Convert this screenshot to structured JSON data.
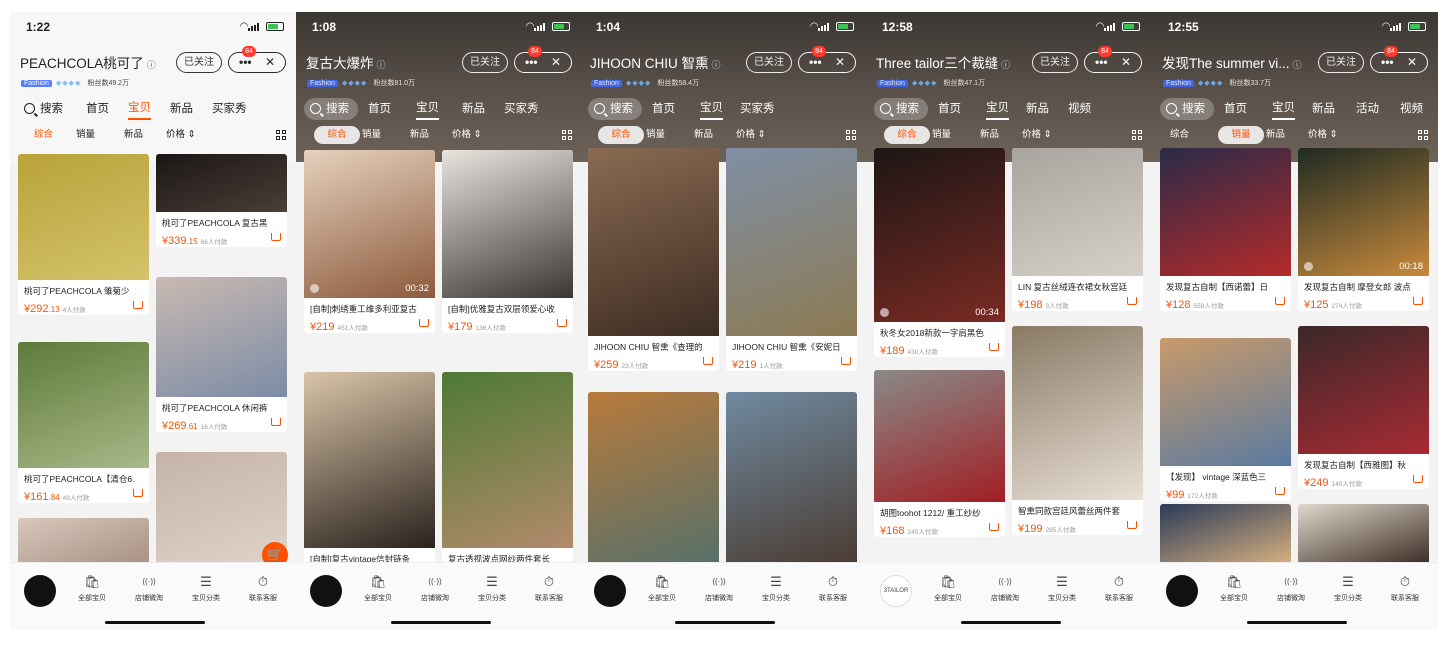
{
  "screens": [
    {
      "theme": "light",
      "time": "1:22",
      "shop_name": "PEACHCOLA桃可了",
      "follow": "已关注",
      "badge": "84",
      "tag": "Fashion",
      "fans": "粉丝数49.2万",
      "search": "搜索",
      "tabs": [
        "首页",
        "宝贝",
        "新品",
        "买家秀"
      ],
      "active_tab": 1,
      "sorts": [
        "综合",
        "销量",
        "新品",
        "价格"
      ],
      "active_sort": 0,
      "left_products": [
        {
          "title": "桃可了PEACHCOLA 雏菊少",
          "price_int": "292",
          "price_dec": ".13",
          "buyers": "4人付款",
          "colors": [
            "#b9a23a",
            "#d4c36a"
          ]
        },
        {
          "title": "桃可了PEACHCOLA【清仓6.",
          "price_int": "161",
          "price_dec": ".84",
          "buyers": "49人付款",
          "colors": [
            "#5d7a3a",
            "#a8b888"
          ]
        },
        {
          "title": "",
          "price_int": "",
          "price_dec": "",
          "buyers": "",
          "colors": [
            "#d8c7bb",
            "#a08a7c"
          ]
        }
      ],
      "right_products": [
        {
          "title": "桃可了PEACHCOLA 复古黑",
          "price_int": "339",
          "price_dec": ".15",
          "buyers": "66人付款",
          "colors": [
            "#1a1615",
            "#4a3e38"
          ]
        },
        {
          "title": "桃可了PEACHCOLA 休闲裤",
          "price_int": "269",
          "price_dec": ".61",
          "buyers": "16人付款",
          "colors": [
            "#c9b9b2",
            "#7c8ca6"
          ]
        },
        {
          "title": "",
          "price_int": "",
          "price_dec": "",
          "buyers": "",
          "colors": [
            "#c5b3a8",
            "#e1d5cc"
          ]
        }
      ],
      "bottom": [
        "全部宝贝",
        "店铺微淘",
        "宝贝分类",
        "联系客服"
      ]
    },
    {
      "theme": "dark",
      "time": "1:08",
      "shop_name": "复古大爆炸",
      "follow": "已关注",
      "badge": "84",
      "tag": "Fashion",
      "fans": "粉丝数81.0万",
      "search": "搜索",
      "tabs": [
        "首页",
        "宝贝",
        "新品",
        "买家秀"
      ],
      "active_tab": 1,
      "sorts": [
        "综合",
        "销量",
        "新品",
        "价格"
      ],
      "active_sort": 0,
      "left_products": [
        {
          "title": "[自制]刺绣重工维多利亚复古",
          "price_int": "219",
          "price_dec": "",
          "buyers": "451人付款",
          "colors": [
            "#e6d1bd",
            "#8c5a3c"
          ],
          "duration": "00:32"
        },
        {
          "title": "[自制]复古vintage信封链条",
          "price_int": "",
          "price_dec": "",
          "buyers": "",
          "colors": [
            "#d9c5a8",
            "#2a221d"
          ]
        }
      ],
      "right_products": [
        {
          "title": "[自制]优雅复古双层领爱心收",
          "price_int": "179",
          "price_dec": "",
          "buyers": "136人付款",
          "colors": [
            "#e8e4de",
            "#3a3633"
          ]
        },
        {
          "title": "复古透视波点网纱两件套长",
          "price_int": "",
          "price_dec": "",
          "buyers": "",
          "colors": [
            "#4e7a34",
            "#b28a6c"
          ]
        }
      ],
      "bottom": [
        "全部宝贝",
        "店铺微淘",
        "宝贝分类",
        "联系客服"
      ]
    },
    {
      "theme": "dark",
      "time": "1:04",
      "shop_name": "JIHOON CHIU 智熏",
      "follow": "已关注",
      "badge": "84",
      "tag": "Fashion",
      "fans": "粉丝数58.4万",
      "search": "搜索",
      "tabs": [
        "首页",
        "宝贝",
        "买家秀"
      ],
      "active_tab": 1,
      "sorts": [
        "综合",
        "销量",
        "新品",
        "价格"
      ],
      "active_sort": 0,
      "left_products": [
        {
          "title": "JIHOON CHIU 智熏《查理的",
          "price_int": "259",
          "price_dec": "",
          "buyers": "23人付款",
          "colors": [
            "#8a6b52",
            "#3c2c22"
          ]
        },
        {
          "title": "",
          "price_int": "",
          "price_dec": "",
          "buyers": "",
          "colors": [
            "#b87a3c",
            "#55706a"
          ]
        }
      ],
      "right_products": [
        {
          "title": "JIHOON CHIU 智熏《安妮日",
          "price_int": "219",
          "price_dec": "",
          "buyers": "1人付款",
          "colors": [
            "#7f8fa6",
            "#8c7a52"
          ]
        },
        {
          "title": "",
          "price_int": "",
          "price_dec": "",
          "buyers": "",
          "colors": [
            "#6f8aa0",
            "#4a3a30"
          ]
        }
      ],
      "bottom": [
        "全部宝贝",
        "店铺微淘",
        "宝贝分类",
        "联系客服"
      ]
    },
    {
      "theme": "dark",
      "time": "12:58",
      "shop_name": "Three tailor三个裁缝",
      "follow": "已关注",
      "badge": "84",
      "tag": "Fashion",
      "fans": "粉丝数47.1万",
      "search": "搜索",
      "tabs": [
        "首页",
        "宝贝",
        "新品",
        "视频"
      ],
      "active_tab": 1,
      "sorts": [
        "综合",
        "销量",
        "新品",
        "价格"
      ],
      "active_sort": 0,
      "left_products": [
        {
          "title": "秋冬女2018新款一字肩黑色",
          "price_int": "189",
          "price_dec": "",
          "buyers": "430人付款",
          "colors": [
            "#1c1614",
            "#7a2a24"
          ],
          "duration": "00:34"
        },
        {
          "title": "胡图toohot 1212/ 重工纱纱",
          "price_int": "168",
          "price_dec": "",
          "buyers": "245人付款",
          "colors": [
            "#8a8a88",
            "#a01e24"
          ]
        }
      ],
      "right_products": [
        {
          "title": "LIN 复古丝绒连衣裙女秋宫廷",
          "price_int": "198",
          "price_dec": "",
          "buyers": "3人付款",
          "colors": [
            "#a8a49e",
            "#d6d1c8"
          ]
        },
        {
          "title": "智熏同款宫廷风蕾丝两件套",
          "price_int": "199",
          "price_dec": "",
          "buyers": "285人付款",
          "colors": [
            "#8a7a66",
            "#e8e0d4"
          ]
        }
      ],
      "bottom": [
        "全部宝贝",
        "店铺微淘",
        "宝贝分类",
        "联系客服"
      ],
      "avatar_text": "3TAILOR"
    },
    {
      "theme": "dark",
      "time": "12:55",
      "shop_name": "发现The summer vi...",
      "follow": "已关注",
      "badge": "84",
      "tag": "Fashion",
      "fans": "粉丝数33.7万",
      "search": "搜索",
      "tabs": [
        "首页",
        "宝贝",
        "新品",
        "活动",
        "视频"
      ],
      "active_tab": 1,
      "sorts": [
        "综合",
        "销量",
        "新品",
        "价格"
      ],
      "active_sort": 1,
      "left_products": [
        {
          "title": "发现复古自制【西诺蕾】日",
          "price_int": "128",
          "price_dec": "",
          "buyers": "558人付款",
          "colors": [
            "#2a2a48",
            "#b52a2a"
          ]
        },
        {
          "title": "【发现】 vintage 深蓝色三",
          "price_int": "99",
          "price_dec": "",
          "buyers": "172人付款",
          "colors": [
            "#c99a6a",
            "#5a7aa0"
          ]
        },
        {
          "title": "",
          "price_int": "",
          "price_dec": "",
          "buyers": "",
          "colors": [
            "#2a3a58",
            "#d8b080"
          ]
        }
      ],
      "right_products": [
        {
          "title": "发现复古自制 摩登女郎 波点",
          "price_int": "125",
          "price_dec": "",
          "buyers": "274人付款",
          "colors": [
            "#1e2a22",
            "#c88a3c"
          ],
          "duration": "00:18"
        },
        {
          "title": "发现复古自制【西雅图】秋",
          "price_int": "249",
          "price_dec": "",
          "buyers": "140人付款",
          "colors": [
            "#3a2828",
            "#a82a34"
          ]
        },
        {
          "title": "",
          "price_int": "",
          "price_dec": "",
          "buyers": "",
          "colors": [
            "#e0d8cc",
            "#3a2c24"
          ]
        }
      ],
      "bottom": [
        "全部宝贝",
        "店铺微淘",
        "宝贝分类",
        "联系客服"
      ]
    }
  ],
  "icons": {
    "bottom": [
      "bag-icon",
      "broadcast-icon",
      "list-icon",
      "service-icon"
    ]
  },
  "accent": "#ff5000"
}
